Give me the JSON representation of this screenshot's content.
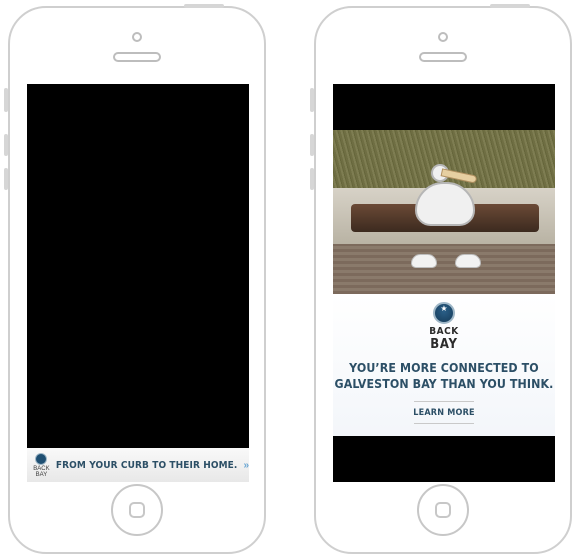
{
  "left_phone": {
    "banner": {
      "logo_text": "BACK\nBAY",
      "text": "FROM YOUR CURB TO THEIR HOME.",
      "chevron": "»"
    }
  },
  "right_phone": {
    "ad": {
      "logo": {
        "line1": "BACK",
        "line2": "BAY"
      },
      "headline_line1": "YOU’RE MORE CONNECTED TO",
      "headline_line2": "GALVESTON BAY THAN YOU THINK.",
      "cta": "LEARN MORE"
    }
  },
  "colors": {
    "headline": "#2c4f66",
    "chevron": "#6aa6d3",
    "phone_outline": "#cfcfcf",
    "screen_bg": "#000000"
  }
}
